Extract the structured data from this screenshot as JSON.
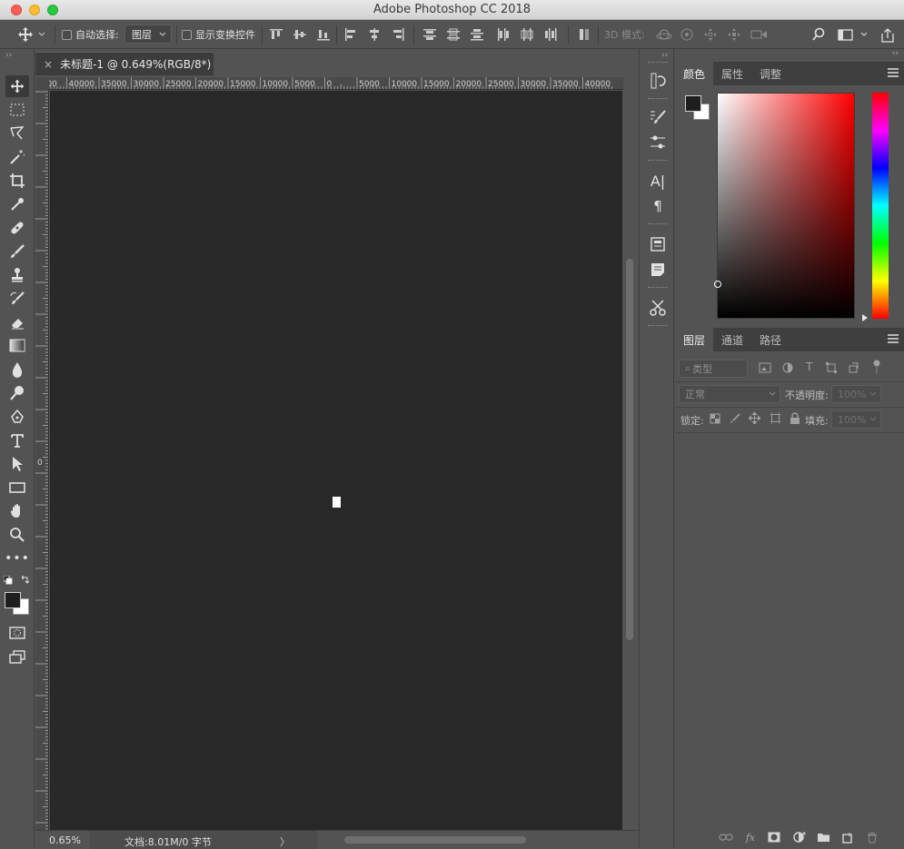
{
  "app": {
    "title": "Adobe Photoshop CC 2018"
  },
  "options_bar": {
    "auto_select_label": "自动选择:",
    "auto_select_target": "图层",
    "show_transform_label": "显示变换控件",
    "mode_3d_label": "3D 模式:"
  },
  "document": {
    "tab_title": "未标题-1 @ 0.649%(RGB/8*)",
    "close_symbol": "×",
    "ruler_labels": [
      "5000",
      "40000",
      "35000",
      "30000",
      "25000",
      "20000",
      "15000",
      "10000",
      "5000",
      "0",
      "5000",
      "10000",
      "15000",
      "20000",
      "25000",
      "30000",
      "35000",
      "40000"
    ],
    "vruler_zero": "0"
  },
  "status_bar": {
    "zoom": "0.65%",
    "doc_info": "文档:8.01M/0 字节",
    "arrow": "〉"
  },
  "color_panel": {
    "tabs": [
      "颜色",
      "属性",
      "调整"
    ],
    "active_tab": "颜色"
  },
  "layers_panel": {
    "tabs": [
      "图层",
      "通道",
      "路径"
    ],
    "active_tab": "图层",
    "filter_placeholder": "类型",
    "blend_mode": "正常",
    "opacity_label": "不透明度:",
    "opacity_value": "100%",
    "lock_label": "锁定:",
    "fill_label": "填充:",
    "fill_value": "100%",
    "fx_label": "fx"
  },
  "colors": {
    "accent_hue_top": "#ff0000",
    "foreground": "#1e1e1e",
    "background": "#ffffff"
  }
}
